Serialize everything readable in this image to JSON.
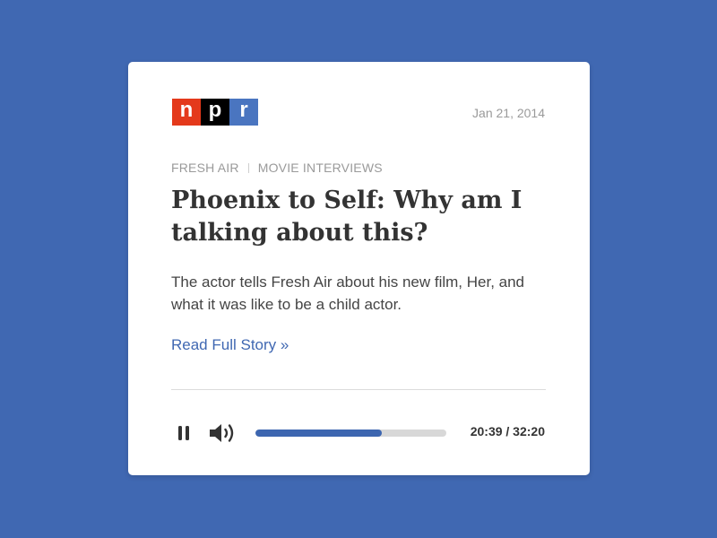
{
  "colors": {
    "background": "#4068b2",
    "card": "#ffffff",
    "logo_n": "#e4391b",
    "logo_p": "#000000",
    "logo_r": "#4a75c0",
    "link": "#4068b2",
    "progress_fill": "#3d66b0",
    "progress_track": "#d8d8d8"
  },
  "logo": {
    "letters": [
      "n",
      "p",
      "r"
    ]
  },
  "story": {
    "date": "Jan 21, 2014",
    "program": "FRESH AIR",
    "category": "MOVIE INTERVIEWS",
    "headline": "Phoenix to Self: Why am I talking about this?",
    "summary": "The actor tells Fresh Air about his new film, Her, and what it was like to be a child actor.",
    "read_more": "Read Full Story »"
  },
  "player": {
    "pause_icon": "pause-icon",
    "volume_icon": "volume-icon",
    "progress": 0.66,
    "time": "20:39 / 32:20"
  }
}
